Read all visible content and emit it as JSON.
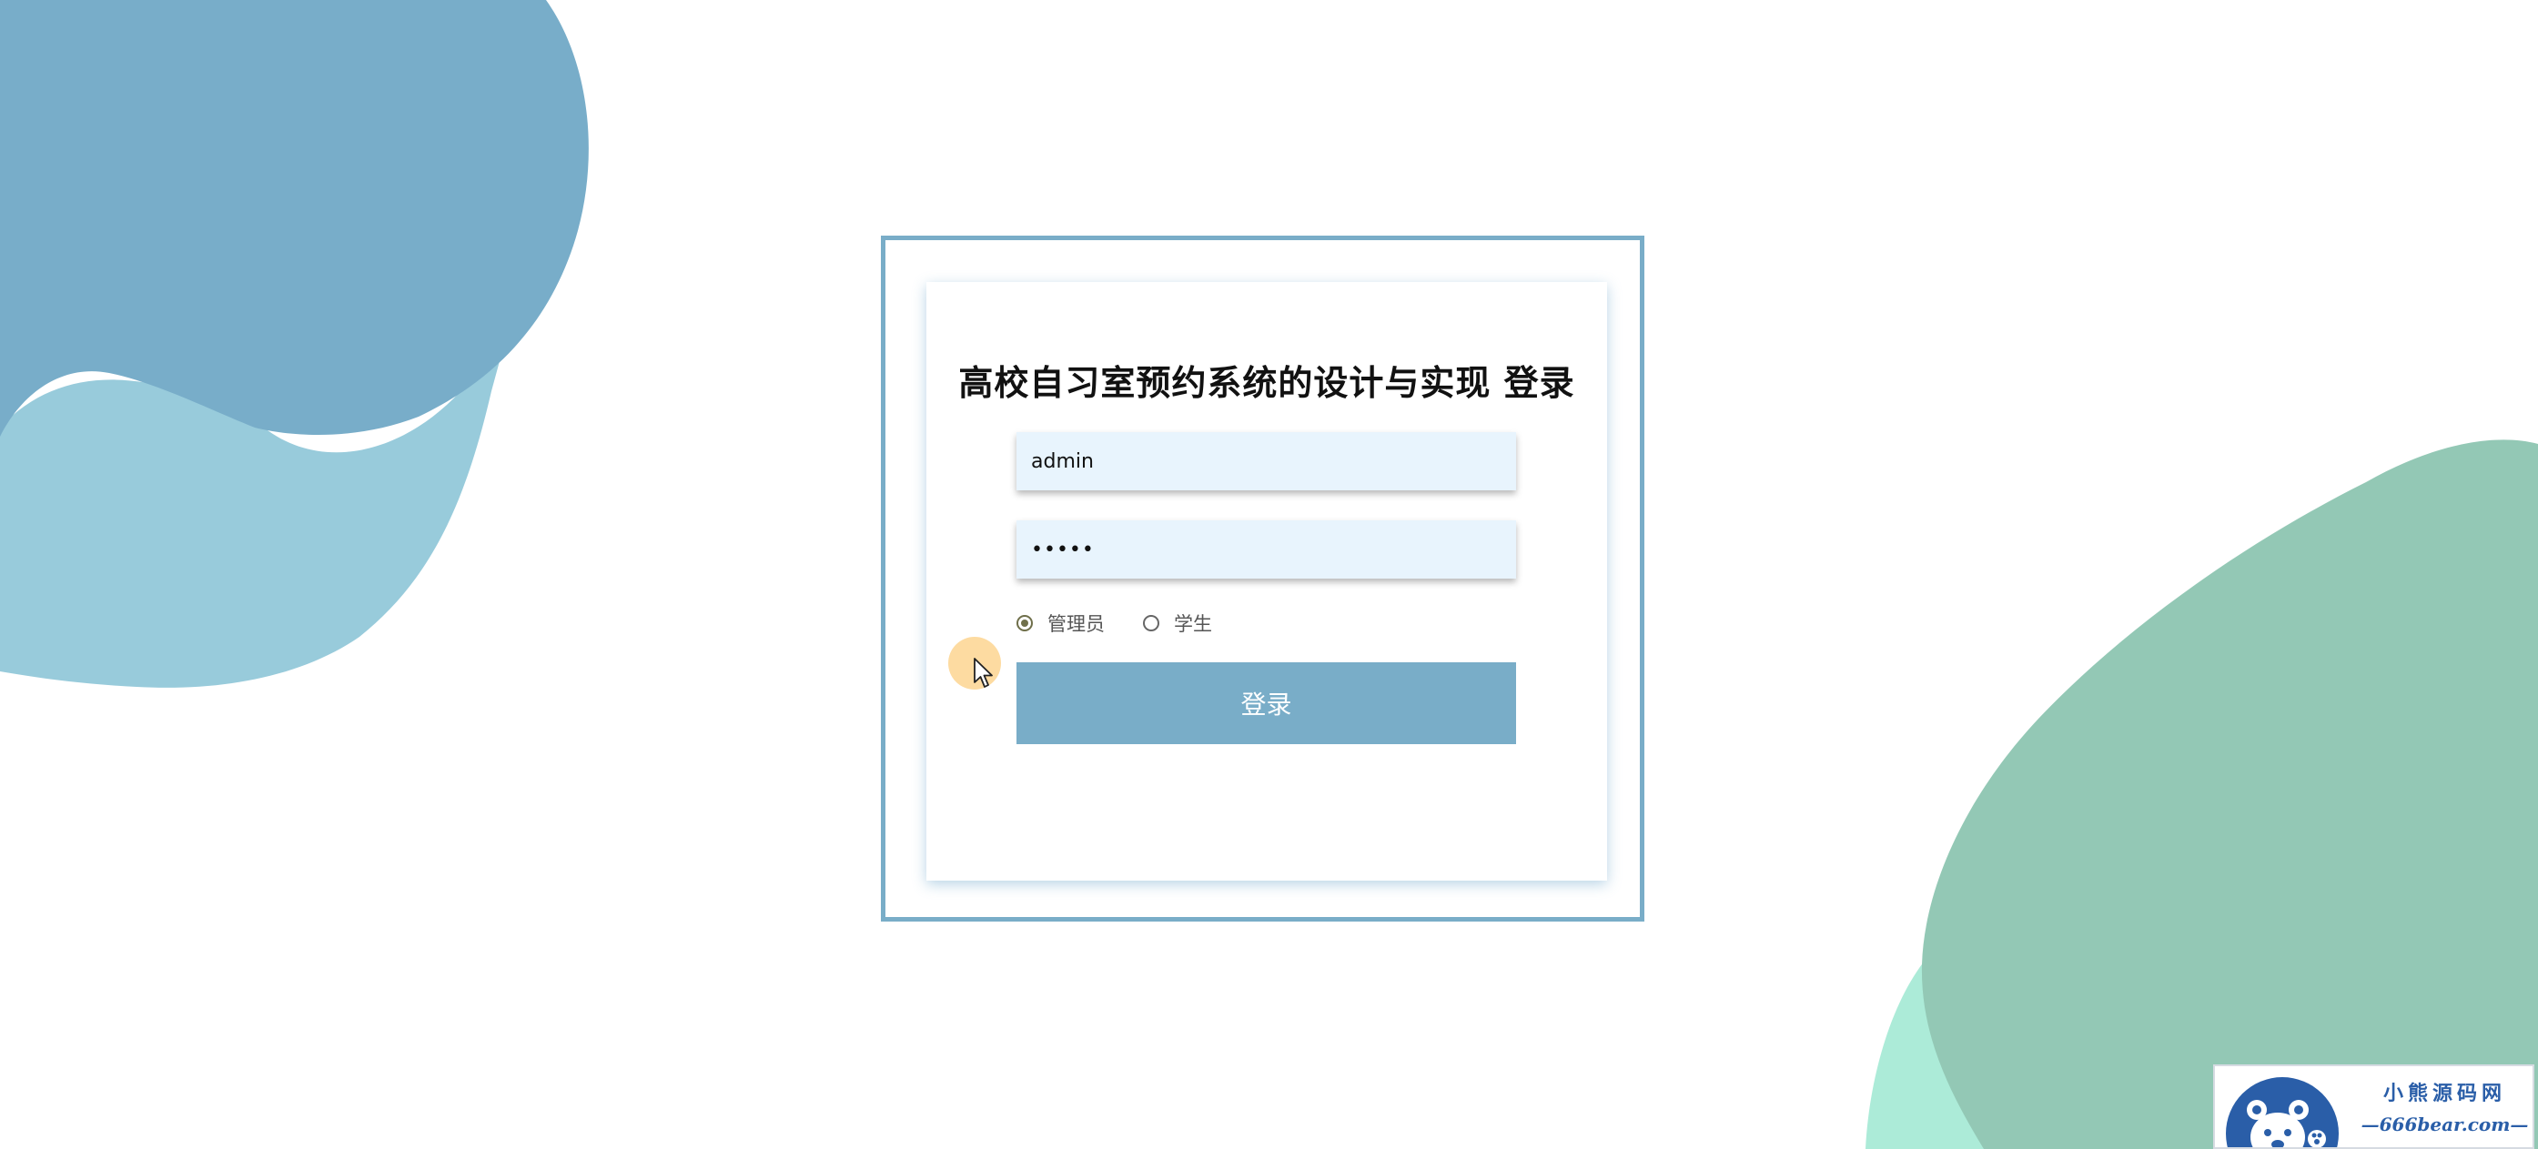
{
  "page": {
    "title": "高校自习室预约系统的设计与实现 登录"
  },
  "form": {
    "username_value": "admin",
    "password_value": "•••••",
    "roles": [
      {
        "label": "管理员",
        "checked": true
      },
      {
        "label": "学生",
        "checked": false
      }
    ],
    "login_label": "登录"
  },
  "watermark": {
    "name": "小熊源码网",
    "domain": "—666bear.com—"
  },
  "colors": {
    "accent": "#79adc8",
    "field_bg": "#e8f4fd",
    "blob_blue_dark": "#78adc9",
    "blob_blue_light": "#98cbdb",
    "blob_green": "#93c8b5",
    "blob_mint": "#acebd8",
    "cursor_highlight": "#fcc86e",
    "watermark_blue": "#2a5ea8"
  }
}
